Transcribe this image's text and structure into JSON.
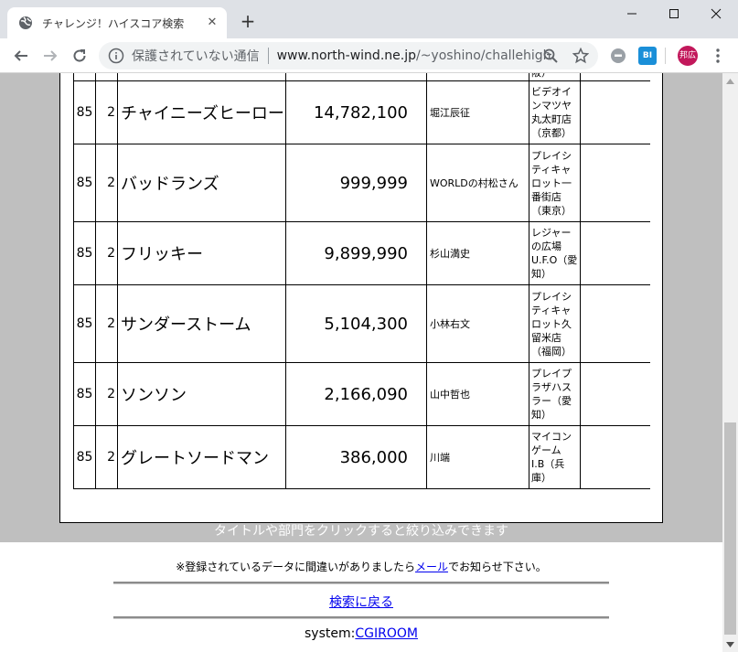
{
  "browser": {
    "tab_title": "チャレンジ！ハイスコア検索",
    "security_warning": "保護されていない通信",
    "url_host": "www.north-wind.ne.jp",
    "url_path": "/~yoshino/challehigh/d...",
    "profile_initials": "邦広",
    "ext_badge": "BI"
  },
  "results": {
    "partial_top_text": "阪）",
    "rows": [
      {
        "score": "85",
        "dept": "2",
        "title": "チャイニーズヒーロー",
        "hiscore": "14,782,100",
        "player": "堀江辰征",
        "shop": [
          "ビデオイ",
          "ンマツヤ",
          "丸太町店",
          "（京都）"
        ]
      },
      {
        "score": "85",
        "dept": "2",
        "title": "バッドランズ",
        "hiscore": "999,999",
        "player": "WORLDの村松さん",
        "shop": [
          "プレイシ",
          "ティキャ",
          "ロット一",
          "番街店",
          "（東京）"
        ]
      },
      {
        "score": "85",
        "dept": "2",
        "title": "フリッキー",
        "hiscore": "9,899,990",
        "player": "杉山満史",
        "shop": [
          "レジャー",
          "の広場",
          "U.F.O（愛",
          "知）"
        ]
      },
      {
        "score": "85",
        "dept": "2",
        "title": "サンダーストーム",
        "hiscore": "5,104,300",
        "player": "小林右文",
        "shop": [
          "プレイシ",
          "ティキャ",
          "ロット久",
          "留米店",
          "（福岡）"
        ]
      },
      {
        "score": "85",
        "dept": "2",
        "title": "ソンソン",
        "hiscore": "2,166,090",
        "player": "山中哲也",
        "shop": [
          "プレイプ",
          "ラザハス",
          "ラー（愛",
          "知）"
        ]
      },
      {
        "score": "85",
        "dept": "2",
        "title": "グレートソードマン",
        "hiscore": "386,000",
        "player": "川端",
        "shop": [
          "マイコン",
          "ゲーム",
          "I.B（兵",
          "庫）"
        ]
      }
    ]
  },
  "page": {
    "filter_hint": "タイトルや部門をクリックすると絞り込みできます",
    "notice_before": "※登録されているデータに間違いがありましたら",
    "notice_link": "メール",
    "notice_after": "でお知らせ下さい。",
    "back_link": "検索に戻る",
    "system_label": "system:",
    "system_link": "CGIROOM"
  }
}
